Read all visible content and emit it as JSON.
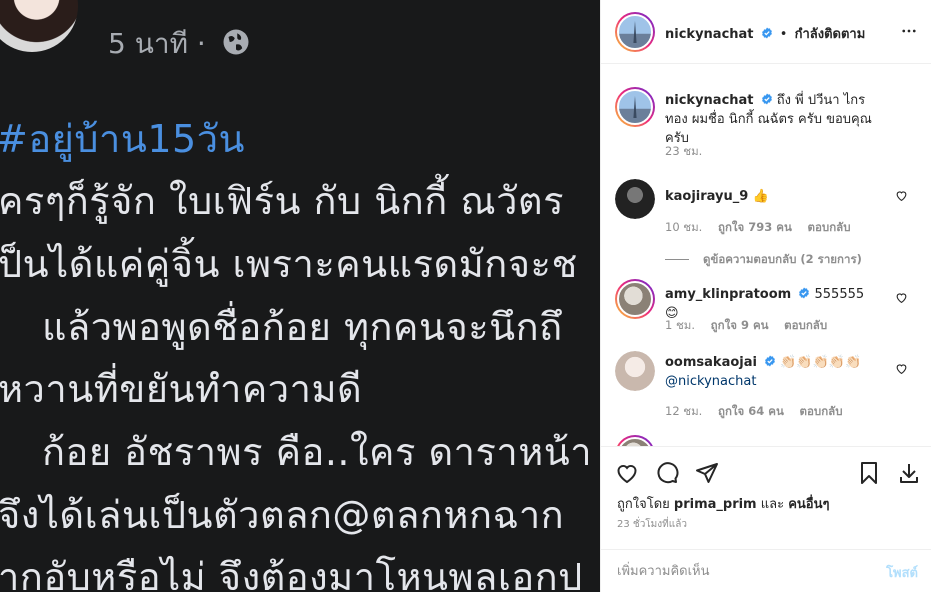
{
  "post_image": {
    "fb_time": "5 นาที ·",
    "lines": [
      "#อยู่บ้าน15วัน",
      "ครๆก็รู้จัก ใบเฟิร์น กับ นิกกี้ ณวัตร",
      "ป็นได้แค่คู่จิ้น เพราะคนแรดมักจะช",
      "แล้วพอพูดชื่อก้อย ทุกคนจะนึกถึ",
      "หวานที่ขยันทำความดี",
      "ก้อย อัชราพร คือ..ใคร ดาราหน้า",
      "จึงได้เล่นเป็นตัวตลก@ตลกหกฉาก",
      "ากอับหรือไม่ จึงต้องมาโหนพลเอกป"
    ]
  },
  "header": {
    "username": "nickynachat",
    "separator": "•",
    "follow_label": "กำลังติดตาม"
  },
  "caption": {
    "username": "nickynachat",
    "text": "ถึง พี่ ปวีนา ไกรทอง ผมชื่อ นิกกี้ ณฉัตร ครับ ขอบคุณครับ",
    "time": "23 ชม."
  },
  "comments": [
    {
      "username": "kaojirayu_9",
      "text": "👍",
      "time": "10 ชม.",
      "likes": "ถูกใจ 793 คน",
      "reply": "ตอบกลับ",
      "view_replies": "ดูข้อความตอบกลับ (2 รายการ)"
    },
    {
      "username": "amy_klinpratoom",
      "text": "555555 😊",
      "time": "1 ชม.",
      "likes": "ถูกใจ 9 คน",
      "reply": "ตอบกลับ"
    },
    {
      "username": "oomsakaojai",
      "text": "👏🏻👏🏻👏🏻👏🏻👏🏻",
      "mention": "@nickynachat",
      "time": "12 ชม.",
      "likes": "ถูกใจ 64 คน",
      "reply": "ตอบกลับ"
    }
  ],
  "actions": {
    "liked_by_prefix": "ถูกใจโดย",
    "liked_by_user": "prima_prim",
    "liked_by_and": "และ",
    "liked_by_others": "คนอื่นๆ",
    "timestamp": "23 ชั่วโมงที่แล้ว"
  },
  "add_comment": {
    "placeholder": "เพิ่มความคิดเห็น",
    "post_label": "โพสต์"
  },
  "colors": {
    "accent": "#0095f6",
    "verified": "#3897f0",
    "post_disabled": "#b2dffc",
    "image_bg": "#18191a",
    "hashtag": "#4a8fe0"
  }
}
